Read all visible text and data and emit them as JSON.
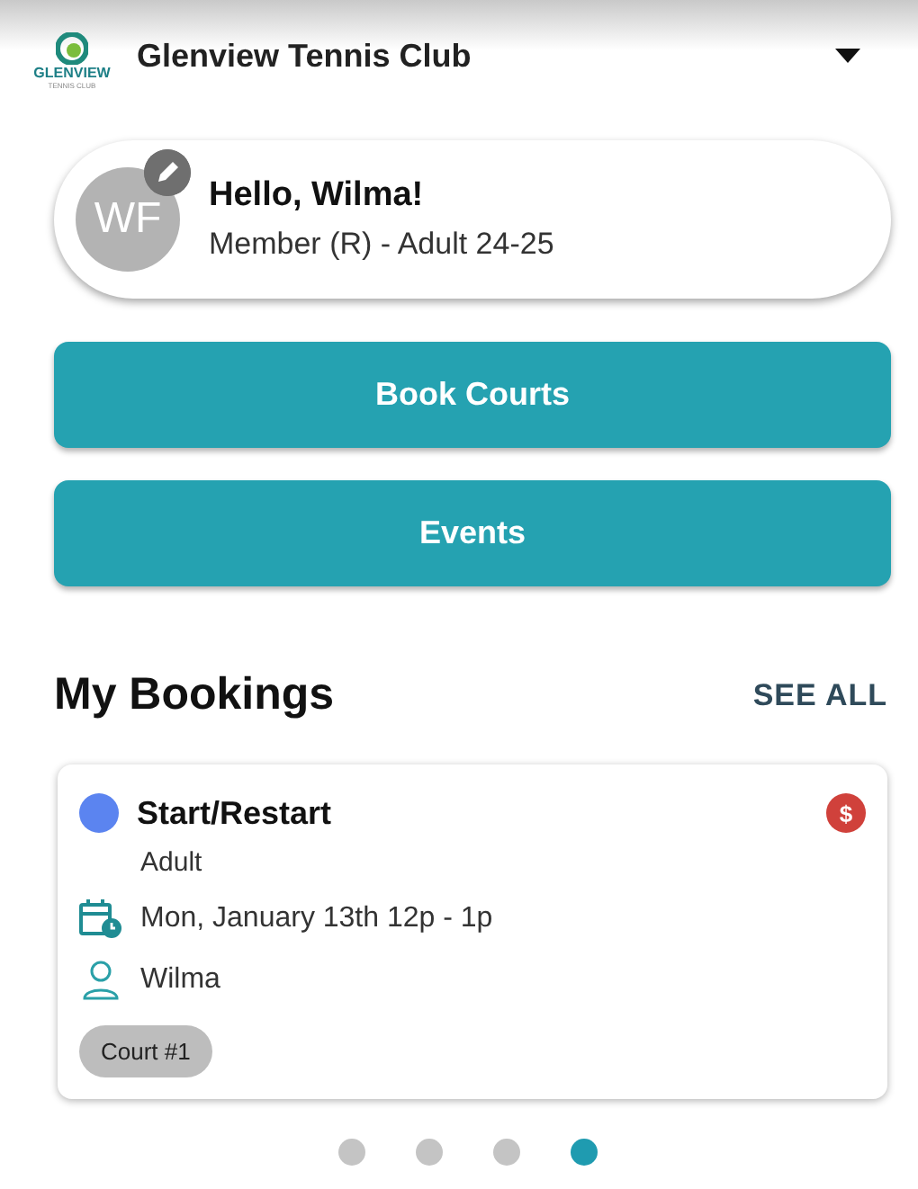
{
  "header": {
    "logo_text": "GLENVIEW",
    "logo_subtext": "TENNIS CLUB",
    "title": "Glenview Tennis Club"
  },
  "profile": {
    "initials": "WF",
    "greeting": "Hello, Wilma!",
    "membership": "Member (R) - Adult 24-25"
  },
  "actions": [
    "Book Courts",
    "Events"
  ],
  "bookings_section": {
    "title": "My Bookings",
    "link": "SEE ALL"
  },
  "bookings": [
    {
      "title": "Start/Restart",
      "color": "#5b84f0",
      "category": "Adult",
      "paid_icon": "$",
      "when": "Mon, January 13th 12p - 1p",
      "player": "Wilma",
      "court": "Court #1"
    }
  ],
  "pager": [
    {
      "selected": false
    },
    {
      "selected": false
    },
    {
      "selected": false
    },
    {
      "selected": true
    }
  ]
}
